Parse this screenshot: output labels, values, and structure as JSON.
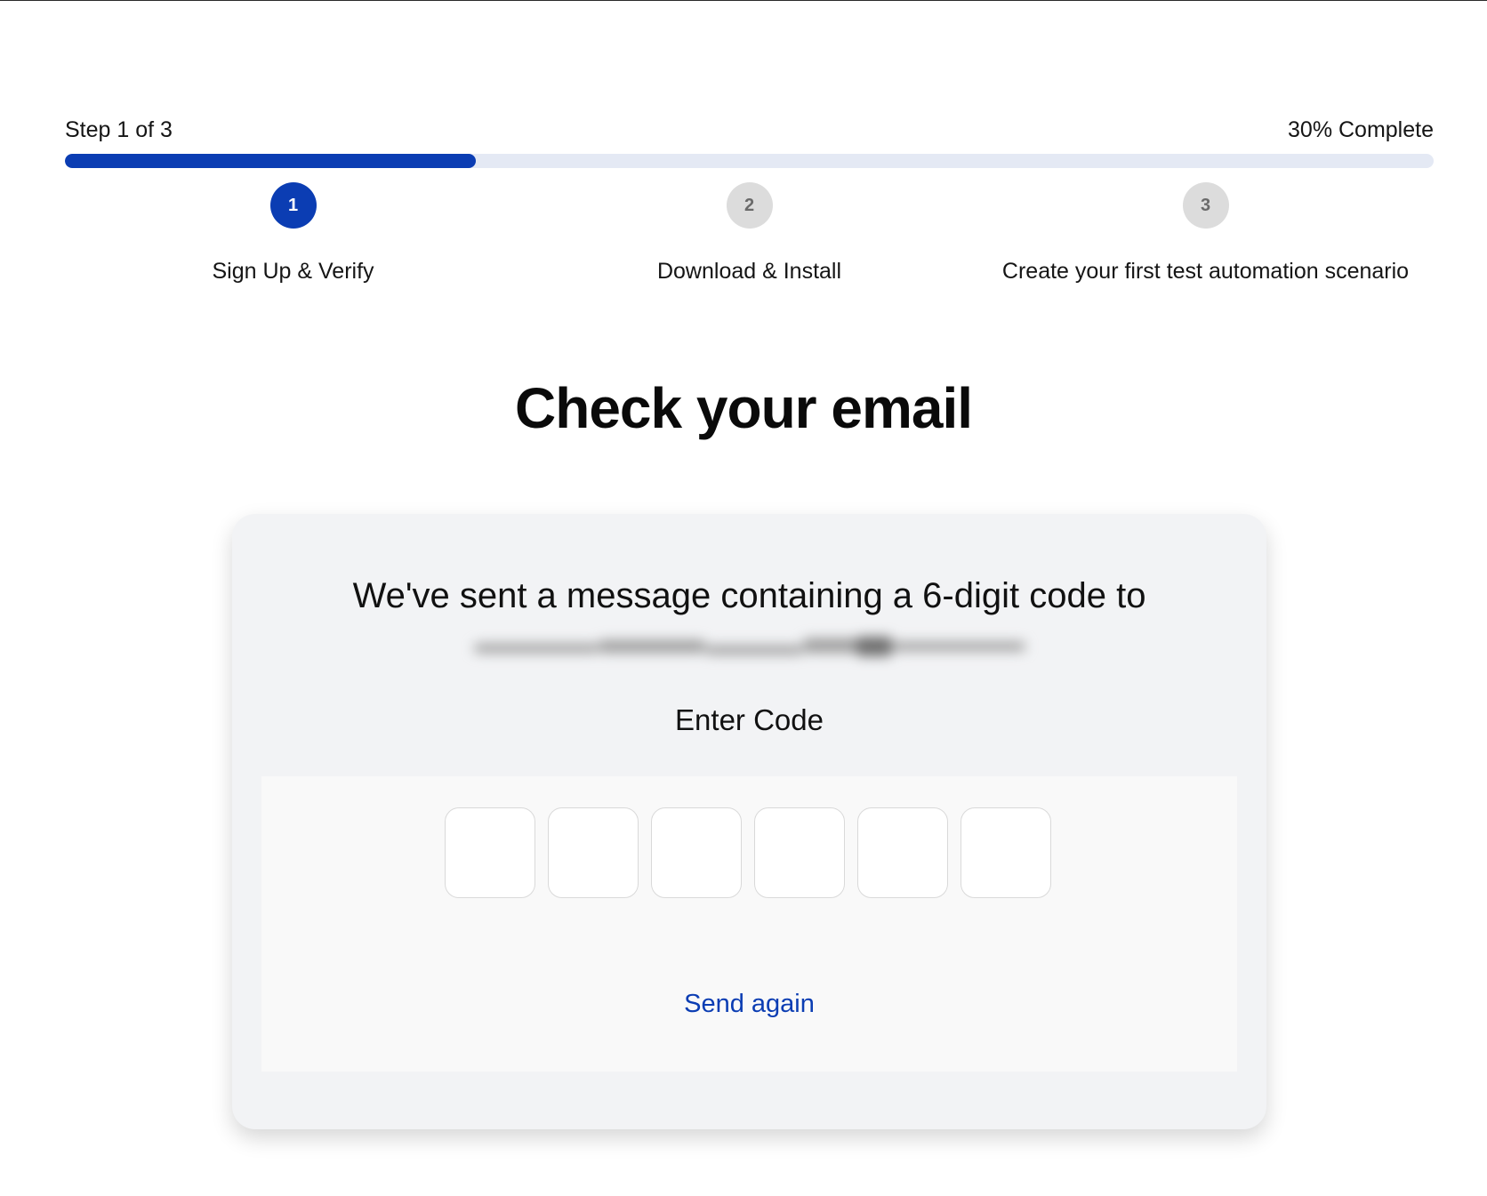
{
  "progress": {
    "step_text": "Step 1 of 3",
    "complete_text": "30% Complete",
    "percent": 30,
    "accent_color": "#0b3db3",
    "track_color": "#e4e9f4"
  },
  "steps": [
    {
      "number": "1",
      "label": "Sign Up & Verify",
      "state": "active"
    },
    {
      "number": "2",
      "label": "Download & Install",
      "state": "inactive"
    },
    {
      "number": "3",
      "label": "Create your first test automation scenario",
      "state": "inactive"
    }
  ],
  "page": {
    "title": "Check your email"
  },
  "card": {
    "message": "We've sent a message containing a 6-digit code to",
    "email_state": "blurred",
    "enter_code_label": "Enter Code",
    "code_length": 6,
    "send_again_label": "Send again"
  }
}
